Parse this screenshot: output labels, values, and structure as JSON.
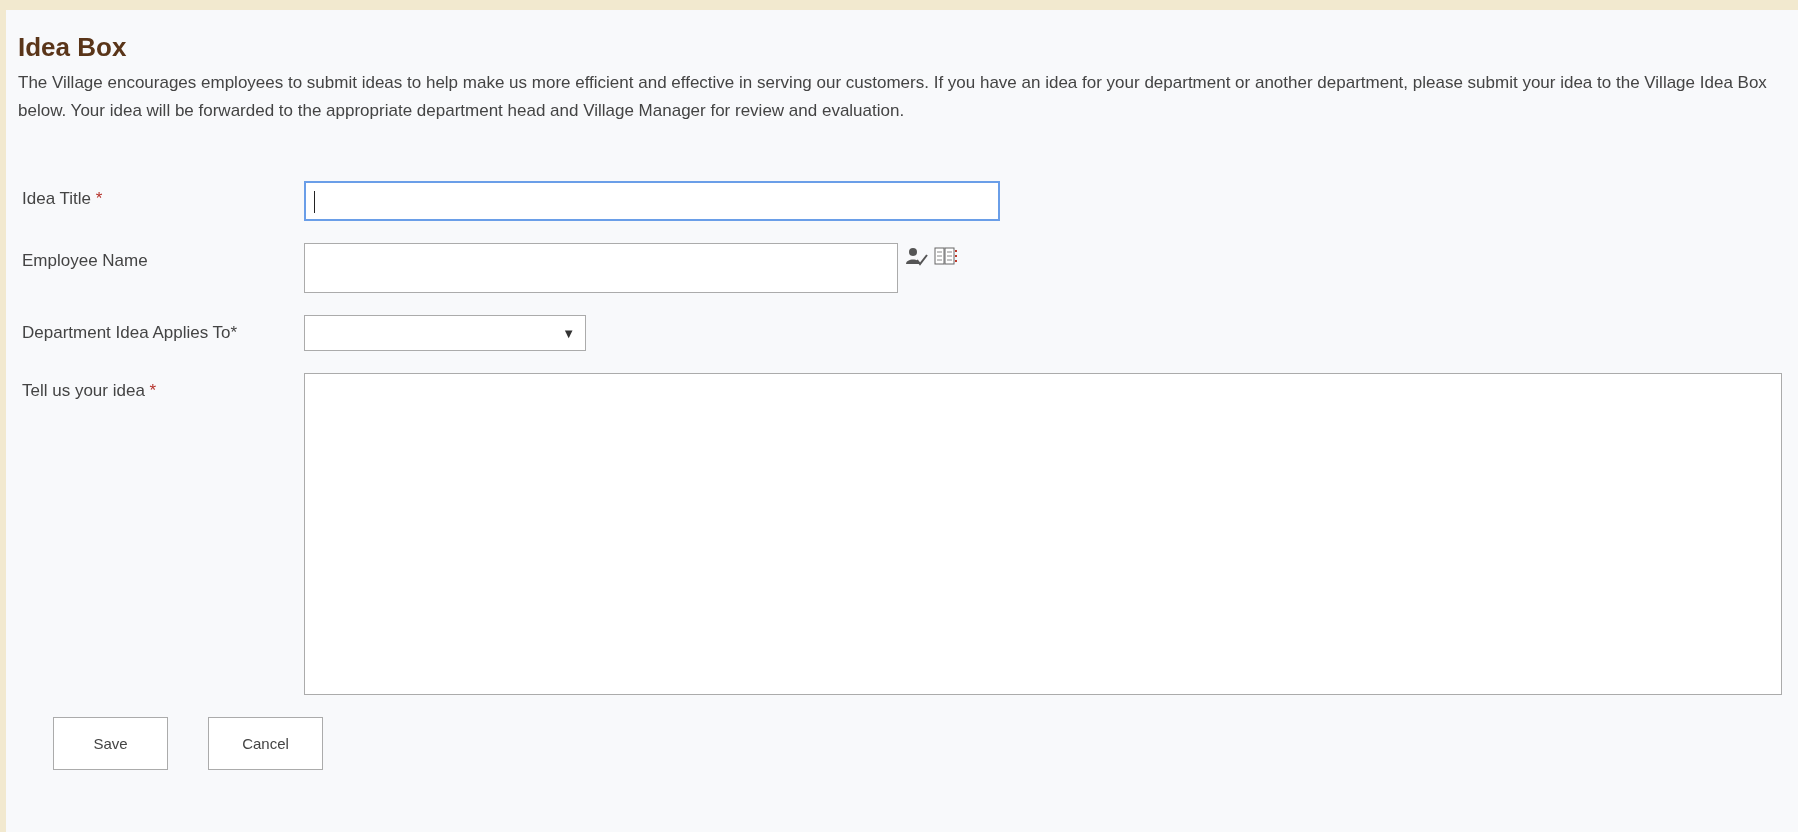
{
  "title": "Idea Box",
  "intro": "The Village encourages employees to submit ideas to help make us more efficient and effective in serving our customers. If you have an idea for your department or another department, please submit your idea to the Village Idea Box below. Your idea will be forwarded to the appropriate department head and Village Manager for review and evaluation.",
  "fields": [
    {
      "kind": "text",
      "label": "Idea Title",
      "required_mark": "*",
      "focused": true
    },
    {
      "kind": "people",
      "label": "Employee Name",
      "focused": false
    },
    {
      "kind": "select",
      "label": "Department Idea Applies To*",
      "arrow": "▼",
      "focused": false
    },
    {
      "kind": "textarea",
      "label": "Tell us your idea",
      "required_mark": "*",
      "focused": false
    }
  ],
  "buttons": [
    "Save",
    "Cancel"
  ]
}
